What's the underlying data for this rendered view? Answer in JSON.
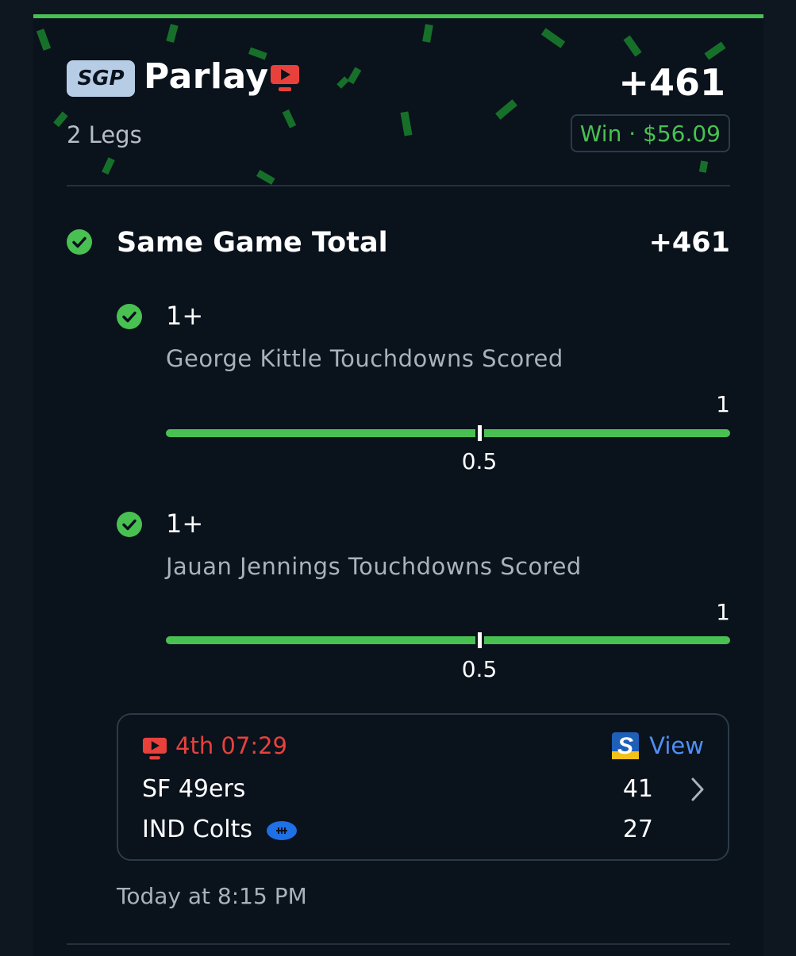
{
  "header": {
    "badge": "SGP",
    "title": "Parlay",
    "odds": "+461",
    "legs": "2 Legs",
    "result": "Win · $56.09"
  },
  "section": {
    "title": "Same Game Total",
    "odds": "+461"
  },
  "legs": [
    {
      "value": "1+",
      "description": "George Kittle Touchdowns Scored",
      "progress": {
        "actual": 1,
        "line": 0.5,
        "actual_label": "1",
        "line_label": "0.5"
      }
    },
    {
      "value": "1+",
      "description": "Jauan Jennings Touchdowns Scored",
      "progress": {
        "actual": 1,
        "line": 0.5,
        "actual_label": "1",
        "line_label": "0.5"
      }
    }
  ],
  "game": {
    "status": "4th 07:29",
    "view_label": "View",
    "teams": [
      {
        "name": "SF 49ers",
        "score": "41"
      },
      {
        "name": "IND Colts",
        "score": "27",
        "possession": true
      }
    ]
  },
  "placed_at": "Today at 8:15 PM",
  "colors": {
    "accent": "#49c152",
    "live": "#e8413c",
    "link": "#4f8ff7",
    "possession": "#1f6fe5"
  },
  "icons": [
    "tv-live-icon",
    "check-circle-icon",
    "sportsbook-logo-icon",
    "chevron-right-icon",
    "football-possession-icon"
  ]
}
